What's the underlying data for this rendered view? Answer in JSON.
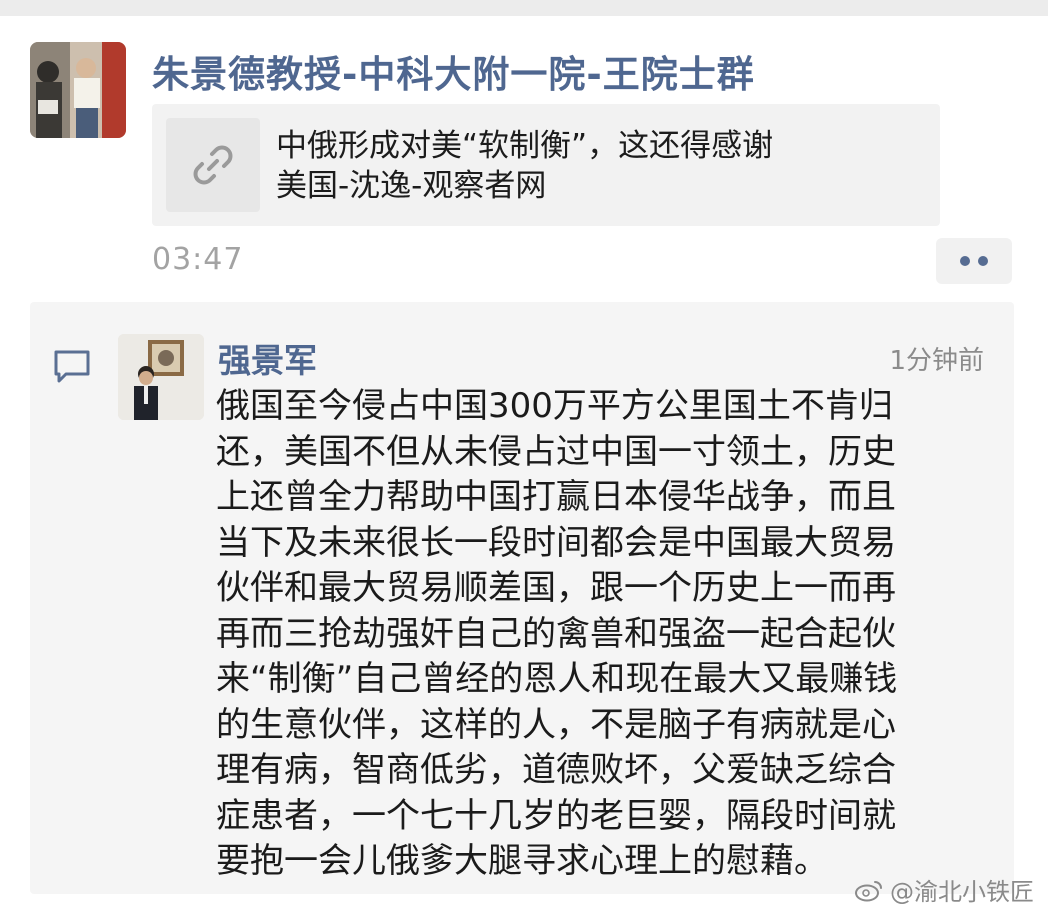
{
  "group": {
    "title": "朱景德教授-中科大附一院-王院士群"
  },
  "shared_link": {
    "title_lines": [
      "中俄形成对美“软制衡”，这还得感谢",
      "美国-沈逸-观察者网"
    ],
    "icon": "link-icon"
  },
  "post": {
    "time": "03:47",
    "more_icon": "more-dots-icon"
  },
  "comment": {
    "icon": "comment-icon",
    "author": "强景军",
    "time": "1分钟前",
    "lines": [
      "俄国至今侵占中国300万平方公里国土不肯归",
      "还，美国不但从未侵占过中国一寸领土，历史",
      "上还曾全力帮助中国打赢日本侵华战争，而且",
      "当下及未来很长一段时间都会是中国最大贸易",
      "伙伴和最大贸易顺差国，跟一个历史上一而再",
      "再而三抢劫强奸自己的禽兽和强盗一起合起伙",
      "来“制衡”自己曾经的恩人和现在最大又最赚钱",
      "的生意伙伴，这样的人，不是脑子有病就是心",
      "理有病，智商低劣，道德败坏，父爱缺乏综合",
      "症患者，一个七十几岁的老巨婴，隔段时间就",
      "要抱一会儿俄爹大腿寻求心理上的慰藉。"
    ]
  },
  "watermark": {
    "text": "@渝北小铁匠",
    "icon": "weibo-icon"
  },
  "colors": {
    "name_blue": "#4f6790",
    "timestamp_gray": "#a3a3a3",
    "card_bg": "#f2f2f2"
  }
}
